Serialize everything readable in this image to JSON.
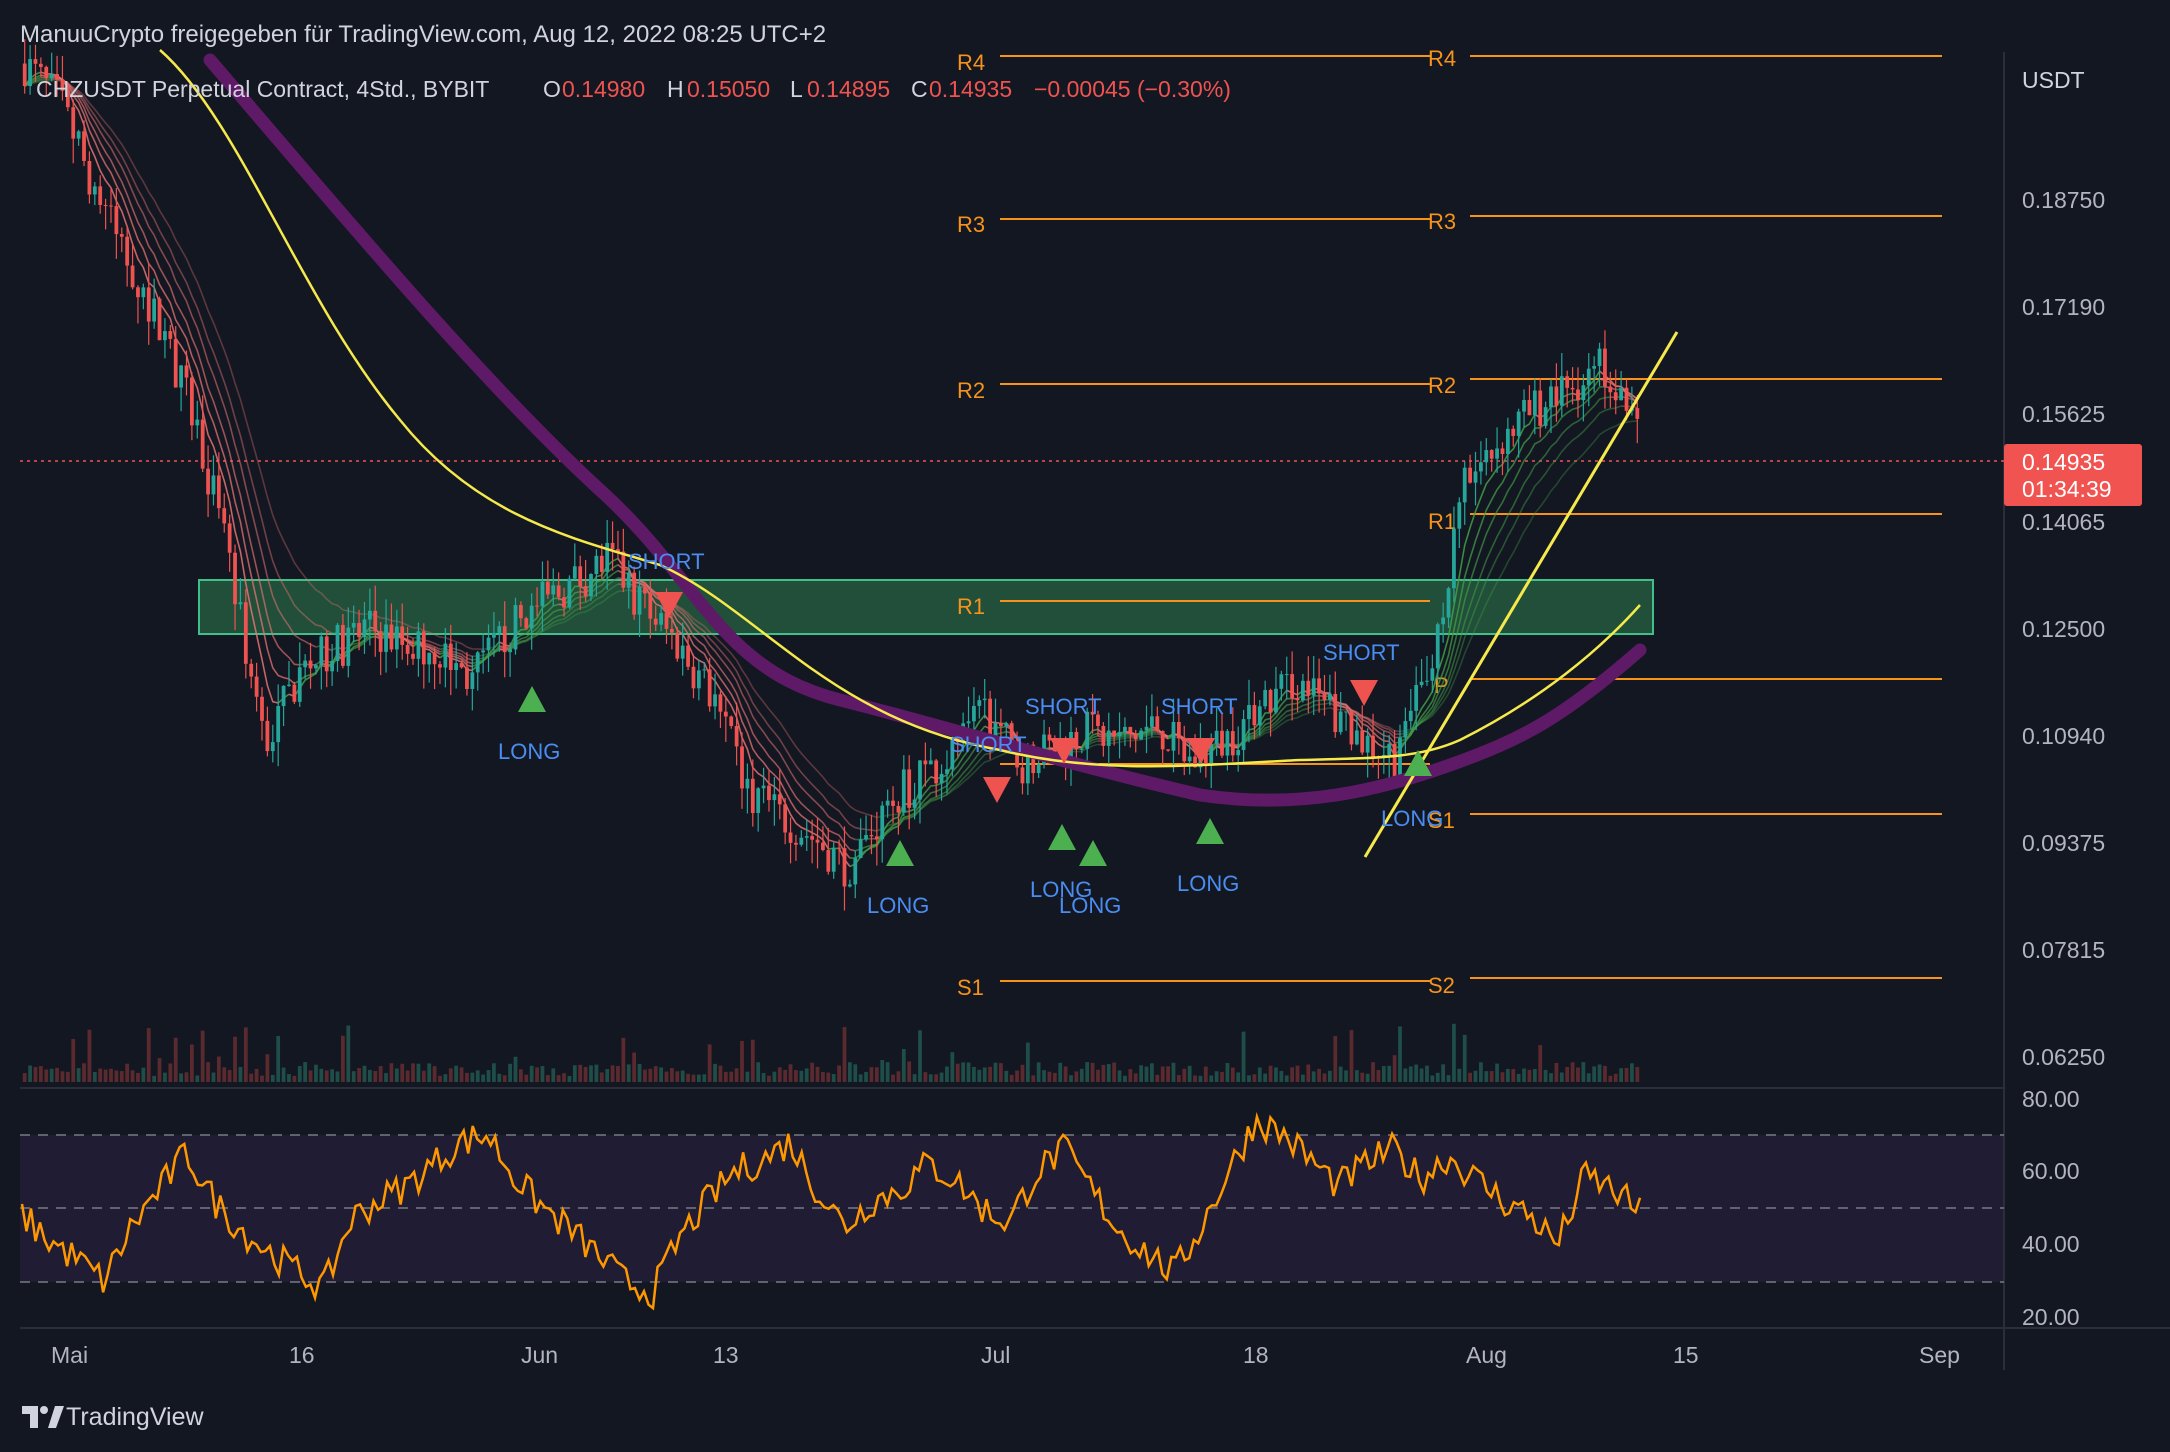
{
  "header": {
    "shared_by": "ManuuCrypto freigegeben für TradingView.com, Aug 12, 2022 08:25 UTC+2"
  },
  "legend": {
    "symbol": "CHZUSDT Perpetual Contract, 4Std., BYBIT",
    "o_label": "O",
    "o_value": "0.14980",
    "h_label": "H",
    "h_value": "0.15050",
    "l_label": "L",
    "l_value": "0.14895",
    "c_label": "C",
    "c_value": "0.14935",
    "change": "−0.00045 (−0.30%)"
  },
  "price_axis": {
    "currency": "USDT",
    "current_price": "0.14935",
    "countdown": "01:34:39",
    "ticks": [
      "0.18750",
      "0.17190",
      "0.15625",
      "0.14065",
      "0.12500",
      "0.10940",
      "0.09375",
      "0.07815",
      "0.06250"
    ]
  },
  "rsi_axis": {
    "ticks": [
      "80.00",
      "60.00",
      "40.00",
      "20.00"
    ]
  },
  "time_axis": {
    "ticks": [
      "Mai",
      "16",
      "Jun",
      "13",
      "Jul",
      "18",
      "Aug",
      "15",
      "Sep"
    ]
  },
  "pivots": {
    "left": [
      "R4",
      "R3",
      "R2",
      "R1",
      "S1"
    ],
    "right": [
      "R4",
      "R3",
      "R2",
      "R1",
      "P",
      "S1",
      "S2"
    ]
  },
  "signals": {
    "short_label": "SHORT",
    "long_label": "LONG"
  },
  "brand": {
    "name": "TradingView"
  },
  "colors": {
    "background": "#131722",
    "candle_up": "#26a69a",
    "candle_down": "#ef5350",
    "pivot_line": "#f7931a",
    "zone": "#2e7d4f",
    "ema_yellow": "#f5e94b",
    "ema_purple": "#6a1b6a",
    "rsi_line": "#ff9800",
    "signal_short": "#ef5350",
    "signal_long": "#4caf50",
    "signal_text": "#4a8cf0"
  },
  "chart_data": {
    "type": "line",
    "title": "CHZUSDT Perpetual Contract, 4Std., BYBIT",
    "x": [
      "Mai",
      "16",
      "Jun",
      "13",
      "Jul",
      "18",
      "Aug",
      "15",
      "Sep"
    ],
    "series": [
      {
        "values": [
          0.196,
          0.191,
          0.18,
          0.17,
          0.16,
          0.148,
          0.129,
          0.105,
          0.115,
          0.118,
          0.121,
          0.119,
          0.118,
          0.114,
          0.12,
          0.124,
          0.127,
          0.13,
          0.124,
          0.119,
          0.112,
          0.1,
          0.096,
          0.093,
          0.089,
          0.096,
          0.101,
          0.104,
          0.11,
          0.103,
          0.105,
          0.107,
          0.106,
          0.108,
          0.103,
          0.106,
          0.11,
          0.114,
          0.11,
          0.106,
          0.104,
          0.116,
          0.14,
          0.146,
          0.15,
          0.153,
          0.156,
          0.149
        ]
      }
    ],
    "pivot_levels_left": {
      "R4": 0.197,
      "R3": 0.184,
      "R2": 0.159,
      "R1": 0.13,
      "S1": 0.075
    },
    "pivot_levels_right": {
      "R4": 0.197,
      "R3": 0.185,
      "R2": 0.159,
      "R1": 0.144,
      "P": 0.119,
      "S1": 0.1,
      "S2": 0.075
    },
    "zone": [
      0.125,
      0.133
    ],
    "ylim": [
      0.0625,
      0.197
    ],
    "rsi": {
      "ylim": [
        20,
        80
      ],
      "guides": [
        70,
        50,
        30
      ],
      "values": [
        48,
        41,
        36,
        30,
        45,
        55,
        65,
        52,
        44,
        38,
        33,
        28,
        47,
        52,
        56,
        62,
        68,
        70,
        58,
        50,
        44,
        37,
        30,
        27,
        42,
        52,
        60,
        63,
        68,
        55,
        45,
        52,
        55,
        62,
        58,
        50,
        46,
        60,
        66,
        55,
        44,
        38,
        32,
        45,
        60,
        74,
        70,
        63,
        56,
        62,
        66,
        58,
        64,
        58,
        52,
        48,
        40,
        59,
        55,
        49
      ]
    }
  }
}
